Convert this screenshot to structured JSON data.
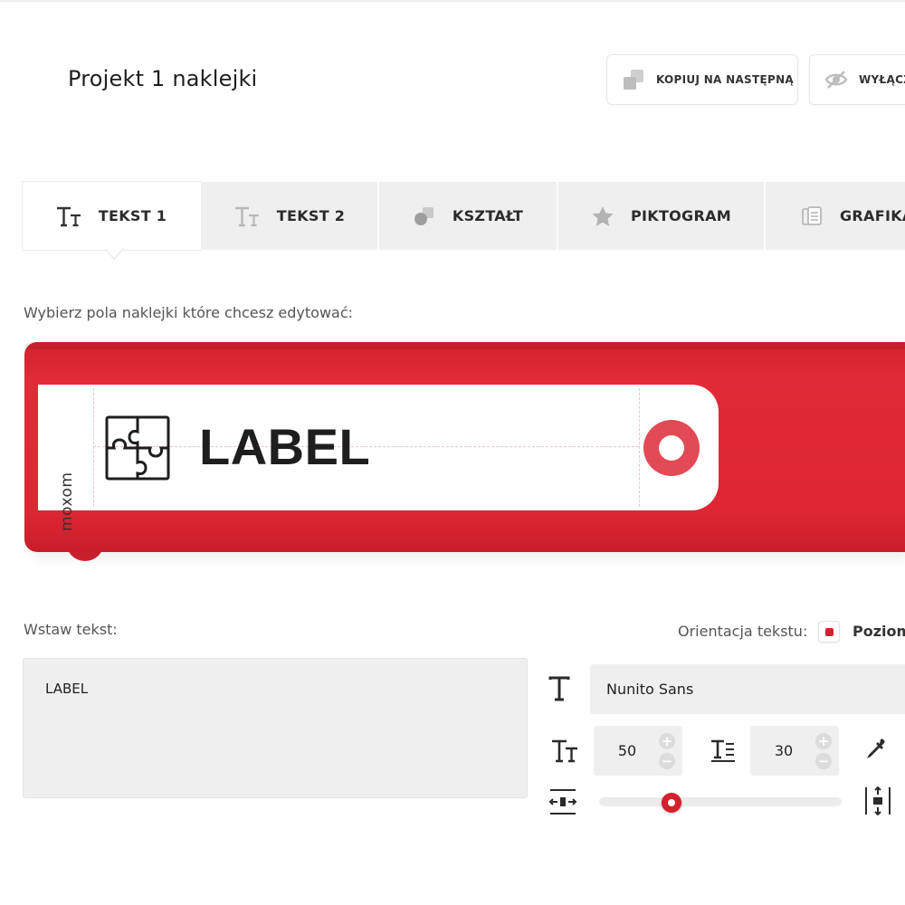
{
  "header": {
    "title": "Projekt 1 naklejki",
    "copy_button": {
      "label": "KOPIUJ NA NASTĘPNĄ",
      "icon": "copy-icon"
    },
    "hide_button": {
      "label": "WYŁĄCZ",
      "icon": "eye-off-icon"
    }
  },
  "tabs": [
    {
      "label": "TEKST 1",
      "icon": "text-size-icon",
      "active": true
    },
    {
      "label": "TEKST 2",
      "icon": "text-size-icon",
      "active": false
    },
    {
      "label": "KSZTAŁT",
      "icon": "shapes-icon",
      "active": false
    },
    {
      "label": "PIKTOGRAM",
      "icon": "star-icon",
      "active": false
    },
    {
      "label": "GRAFIKA",
      "icon": "image-files-icon",
      "active": false
    }
  ],
  "preview": {
    "instruction": "Wybierz pola naklejki które chcesz edytować:",
    "brand": "moxom",
    "label_text": "LABEL",
    "pictogram": "puzzle-icon",
    "binder_color": "#de2634"
  },
  "editor": {
    "insert_label": "Wstaw tekst:",
    "text_value": "LABEL",
    "orientation_label": "Orientacja tekstu:",
    "orientation_value": "Poziom",
    "font_family": "Nunito Sans",
    "font_size": "50",
    "line_height": "30",
    "spacing_fraction": 0.3,
    "plus": "+",
    "minus": "−"
  },
  "colors": {
    "accent": "#d41f2d",
    "tab_bg": "#efefef",
    "field_bg": "#efefef"
  }
}
